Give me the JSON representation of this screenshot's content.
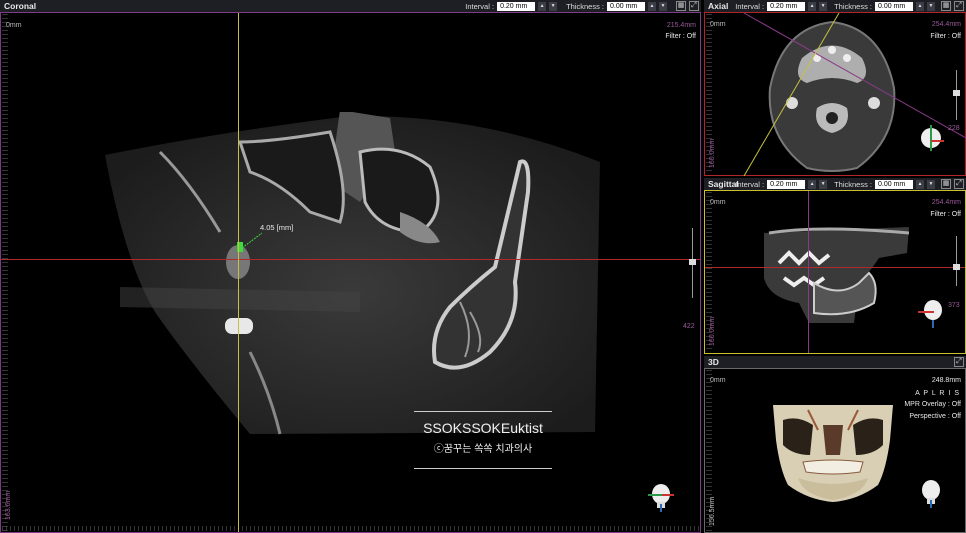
{
  "coronal": {
    "title": "Coronal",
    "interval_label": "Interval :",
    "interval_value": "0.20 mm",
    "thickness_label": "Thickness :",
    "thickness_value": "0.00 mm",
    "scale_top_left": "0mm",
    "scale_top_right": "215.4mm",
    "filter": "Filter : Off",
    "slider_value": "422",
    "scale_bottom_left": "163.6mm",
    "measurement": "4.05 [mm]",
    "watermark_title": "SSOKSSOKEuktist",
    "watermark_sub": "ⓒ꿈꾸는 쏙쏙 치과의사"
  },
  "axial": {
    "title": "Axial",
    "interval_label": "Interval :",
    "interval_value": "0.20 mm",
    "thickness_label": "Thickness :",
    "thickness_value": "0.00 mm",
    "scale_top_left": "0mm",
    "scale_top_right": "254.4mm",
    "filter": "Filter : Off",
    "slider_value": "228",
    "scale_bottom_left": "160.0mm"
  },
  "sagittal": {
    "title": "Sagittal",
    "interval_label": "Interval :",
    "interval_value": "0.20 mm",
    "thickness_label": "Thickness :",
    "thickness_value": "0.00 mm",
    "scale_top_left": "0mm",
    "scale_top_right": "254.4mm",
    "filter": "Filter : Off",
    "slider_value": "373",
    "scale_bottom_left": "160.0mm"
  },
  "view3d": {
    "title": "3D",
    "scale_top_left": "0mm",
    "scale_top_right": "248.8mm",
    "orient": "A P L R I S",
    "mpr_overlay": "MPR Overlay : Off",
    "perspective": "Perspective : Off",
    "scale_bottom_left": "156.5mm"
  },
  "colors": {
    "coronal_frame": "#7d3d86",
    "axial_frame": "#b0262a",
    "sagittal_frame": "#c8c02c",
    "view3d_frame": "#6a6a6a",
    "crosshair_red": "#b02a2a",
    "crosshair_yellow": "#c8c040",
    "measure_green": "#3ddc3d"
  }
}
